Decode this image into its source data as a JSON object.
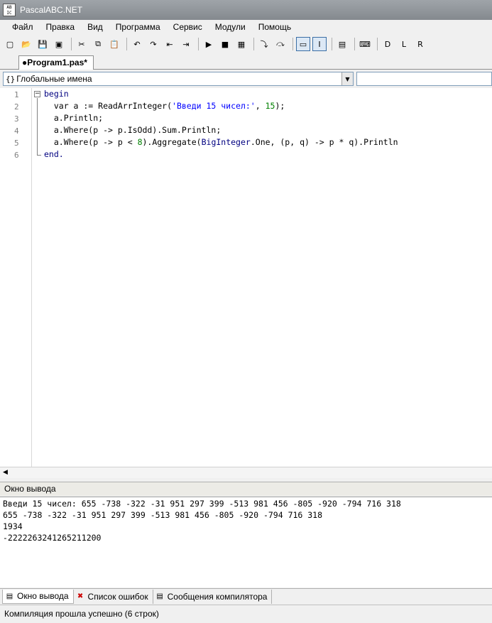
{
  "window": {
    "title": "PascalABC.NET",
    "icon_text": "AB IC"
  },
  "menu": [
    "Файл",
    "Правка",
    "Вид",
    "Программа",
    "Сервис",
    "Модули",
    "Помощь"
  ],
  "toolbar": [
    {
      "icon": "new-file-icon",
      "glyph": "▢"
    },
    {
      "icon": "open-folder-icon",
      "glyph": "📂"
    },
    {
      "icon": "save-icon",
      "glyph": "💾"
    },
    {
      "icon": "save-all-icon",
      "glyph": "▣"
    },
    {
      "sep": true
    },
    {
      "icon": "cut-icon",
      "glyph": "✂"
    },
    {
      "icon": "copy-icon",
      "glyph": "⧉"
    },
    {
      "icon": "paste-icon",
      "glyph": "📋"
    },
    {
      "sep": true
    },
    {
      "icon": "undo-icon",
      "glyph": "↶"
    },
    {
      "icon": "redo-icon",
      "glyph": "↷"
    },
    {
      "icon": "navigate-back-icon",
      "glyph": "⇤"
    },
    {
      "icon": "navigate-forward-icon",
      "glyph": "⇥"
    },
    {
      "sep": true
    },
    {
      "icon": "run-icon",
      "glyph": "▶"
    },
    {
      "icon": "stop-icon",
      "glyph": "■"
    },
    {
      "icon": "compile-icon",
      "glyph": "▦"
    },
    {
      "sep": true
    },
    {
      "icon": "step-into-icon",
      "glyph": "⤵"
    },
    {
      "icon": "step-over-icon",
      "glyph": "⤼"
    },
    {
      "sep": true
    },
    {
      "icon": "console-output-icon",
      "glyph": "▭",
      "pressed": true
    },
    {
      "icon": "text-cursor-icon",
      "glyph": "I",
      "pressed": true
    },
    {
      "sep": true
    },
    {
      "icon": "form-icon",
      "glyph": "▤"
    },
    {
      "sep": true
    },
    {
      "icon": "code-icon",
      "glyph": "⌨"
    },
    {
      "sep": true
    },
    {
      "icon": "tool-d-icon",
      "glyph": "D"
    },
    {
      "icon": "tool-l-icon",
      "glyph": "L"
    },
    {
      "icon": "tool-r-icon",
      "glyph": "R"
    }
  ],
  "tab": {
    "label": "●Program1.pas*"
  },
  "navigation": {
    "braces": "{}",
    "scope": "Глобальные имена"
  },
  "editor": {
    "line_numbers": [
      "1",
      "2",
      "3",
      "4",
      "5",
      "6"
    ],
    "lines": [
      [
        {
          "t": "begin",
          "c": "kw"
        }
      ],
      [
        {
          "t": "  var a := ReadArrInteger(",
          "c": ""
        },
        {
          "t": "'Введи 15 чисел:'",
          "c": "str"
        },
        {
          "t": ", ",
          "c": ""
        },
        {
          "t": "15",
          "c": "num"
        },
        {
          "t": ");",
          "c": ""
        }
      ],
      [
        {
          "t": "  a.Println;",
          "c": ""
        }
      ],
      [
        {
          "t": "  a.Where(p -> p.IsOdd).Sum.Println;",
          "c": ""
        }
      ],
      [
        {
          "t": "  a.Where(p -> p < ",
          "c": ""
        },
        {
          "t": "8",
          "c": "num"
        },
        {
          "t": ").Aggregate(",
          "c": ""
        },
        {
          "t": "BigInteger",
          "c": "ty"
        },
        {
          "t": ".One, (p, q) -> p * q).Println",
          "c": ""
        }
      ],
      [
        {
          "t": "end.",
          "c": "kw"
        }
      ]
    ]
  },
  "output": {
    "header": "Окно вывода",
    "lines": [
      "Введи 15 чисел: 655 -738 -322 -31 951 297 399 -513 981 456 -805 -920 -794 716 318",
      "655 -738 -322 -31 951 297 399 -513 981 456 -805 -920 -794 716 318",
      "1934",
      "-2222263241265211200"
    ]
  },
  "bottom_tabs": [
    {
      "label": "Окно вывода",
      "icon": "output-window-icon",
      "glyph": "▤",
      "active": true
    },
    {
      "label": "Список ошибок",
      "icon": "error-list-icon",
      "glyph": "✖",
      "active": false
    },
    {
      "label": "Сообщения компилятора",
      "icon": "compiler-messages-icon",
      "glyph": "▤",
      "active": false
    }
  ],
  "status": "Компиляция прошла успешно (6 строк)"
}
